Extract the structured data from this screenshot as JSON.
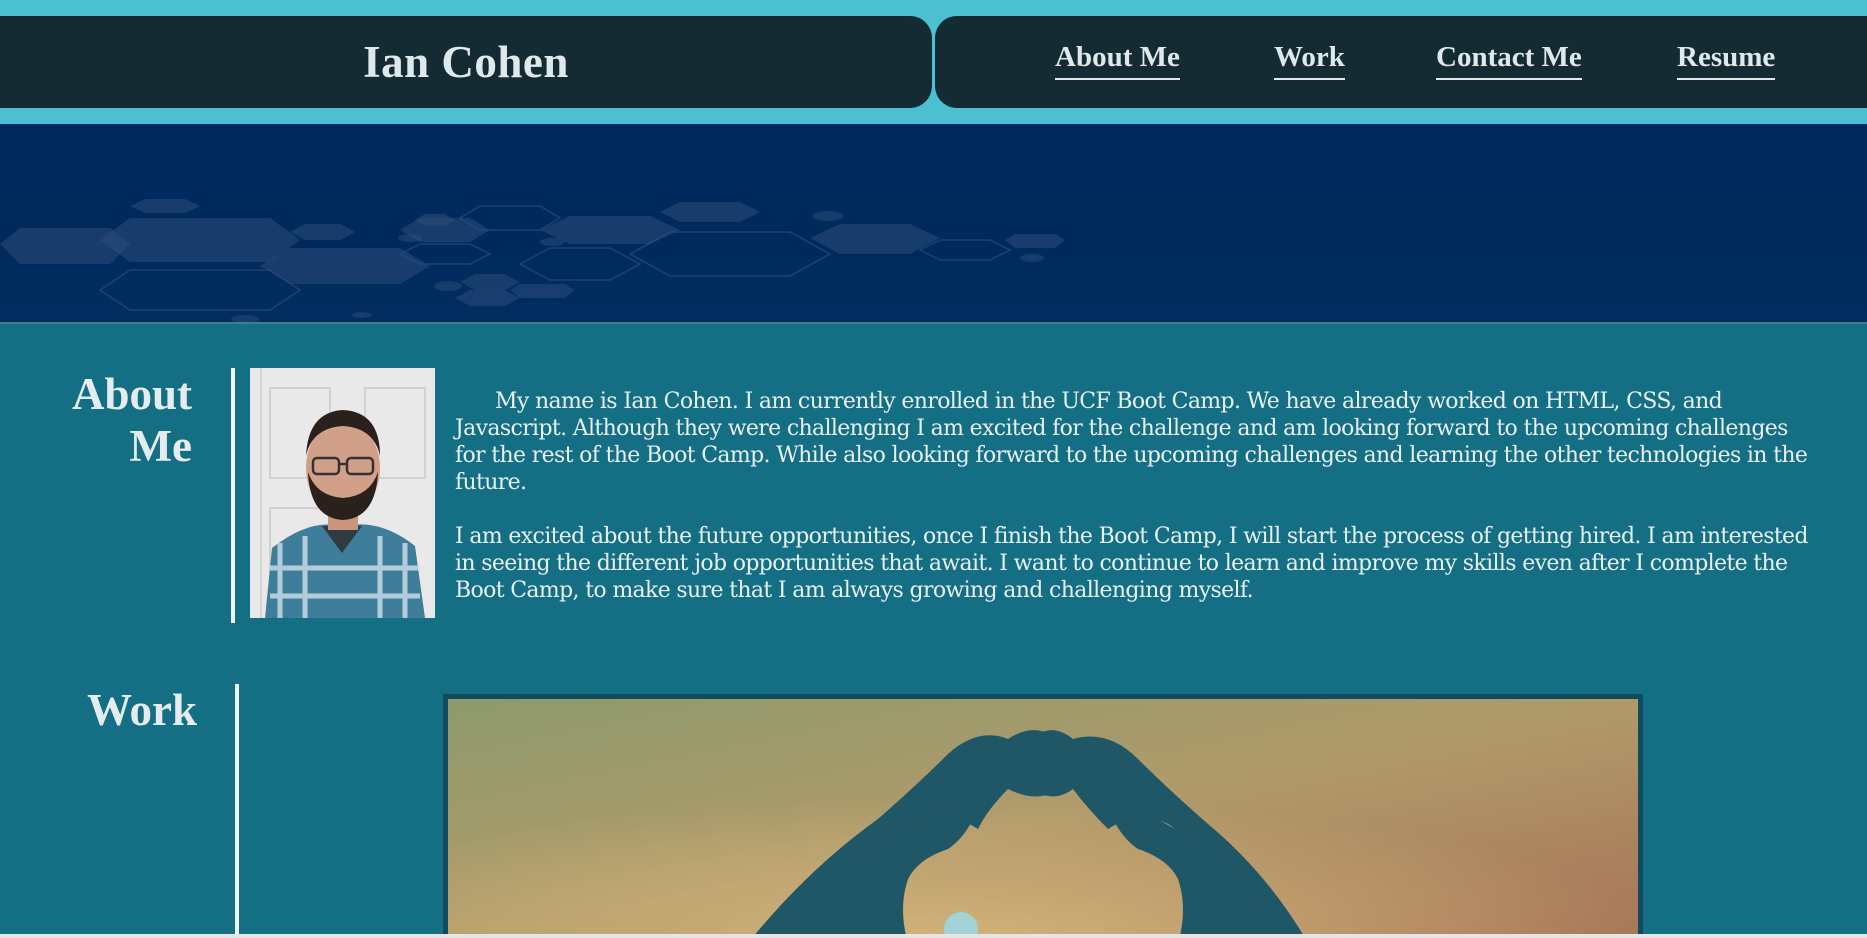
{
  "header": {
    "title": "Ian Cohen",
    "nav": [
      "About Me",
      "Work",
      "Contact Me",
      "Resume"
    ]
  },
  "about": {
    "heading_line1": "About",
    "heading_line2": "Me",
    "paragraph1": "My name is Ian Cohen. I am currently enrolled in the UCF Boot Camp. We have already worked on HTML, CSS, and Javascript. Although they were challenging I am excited for the challenge and am looking forward to the upcoming challenges for the rest of the Boot Camp. While also looking forward to the upcoming challenges and learning the other technologies in the future.",
    "paragraph2": "I am excited about the future opportunities, once I finish the Boot Camp, I will start the process of getting hired. I am interested in seeing the different job opportunities that await. I want to continue to learn and improve my skills even after I complete the Boot Camp, to make sure that I am always growing and challenging myself."
  },
  "work": {
    "heading": "Work"
  },
  "colors": {
    "accent": "#4cbfd0",
    "header_bg": "#142b33",
    "hero_bg": "#002a5e",
    "page_bg": "#146e84"
  }
}
